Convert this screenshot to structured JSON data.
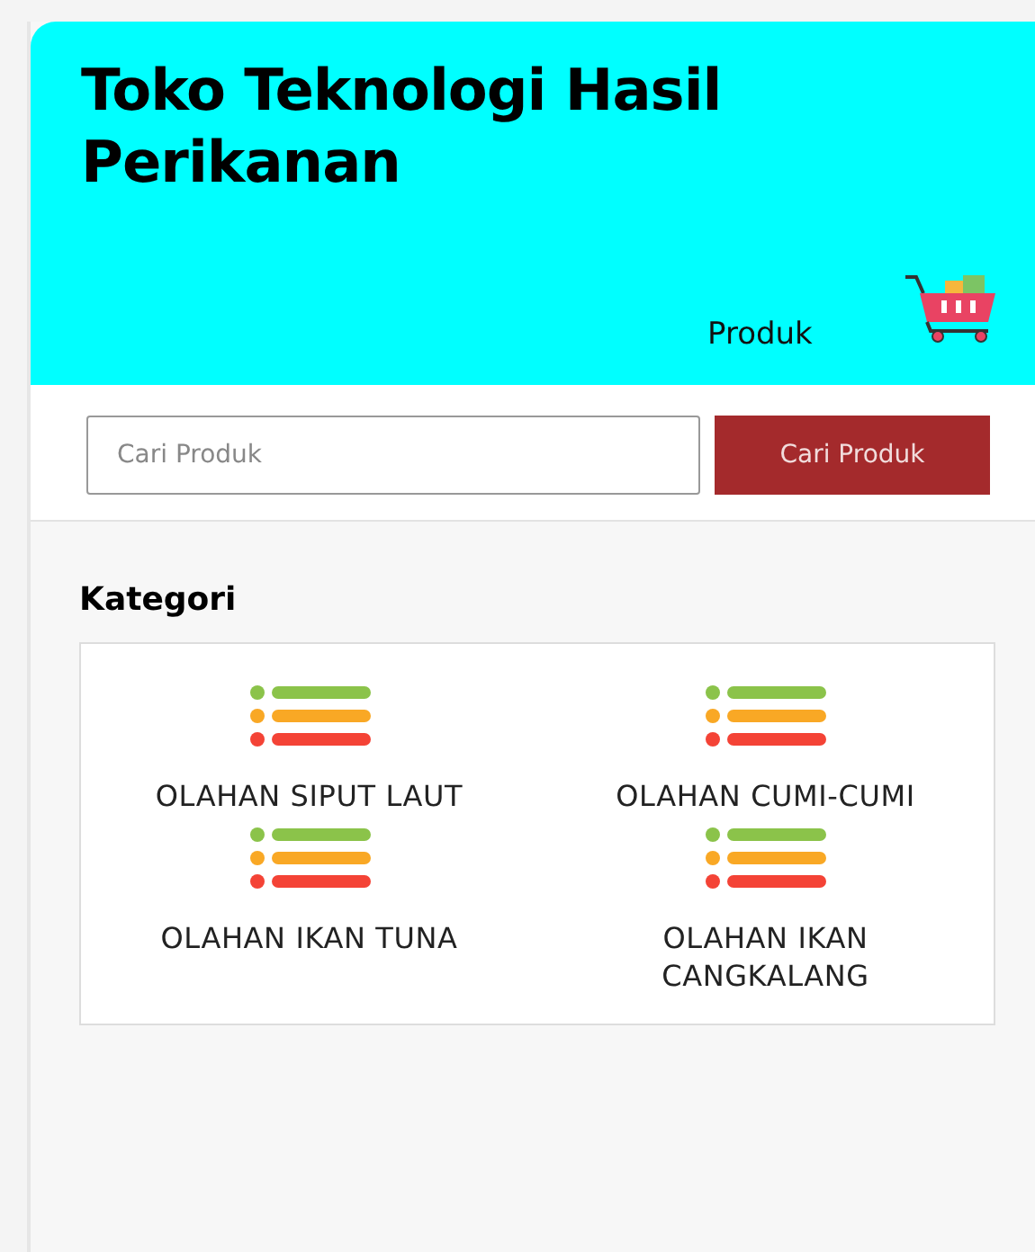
{
  "header": {
    "title": "Toko Teknologi Hasil Perikanan",
    "nav_link": "Produk"
  },
  "search": {
    "placeholder": "Cari Produk",
    "button": "Cari Produk"
  },
  "categories": {
    "title": "Kategori",
    "items": [
      {
        "label": "OLAHAN SIPUT LAUT"
      },
      {
        "label": "OLAHAN CUMI-CUMI"
      },
      {
        "label": "OLAHAN IKAN TUNA"
      },
      {
        "label": "OLAHAN IKAN CANGKALANG"
      }
    ]
  }
}
